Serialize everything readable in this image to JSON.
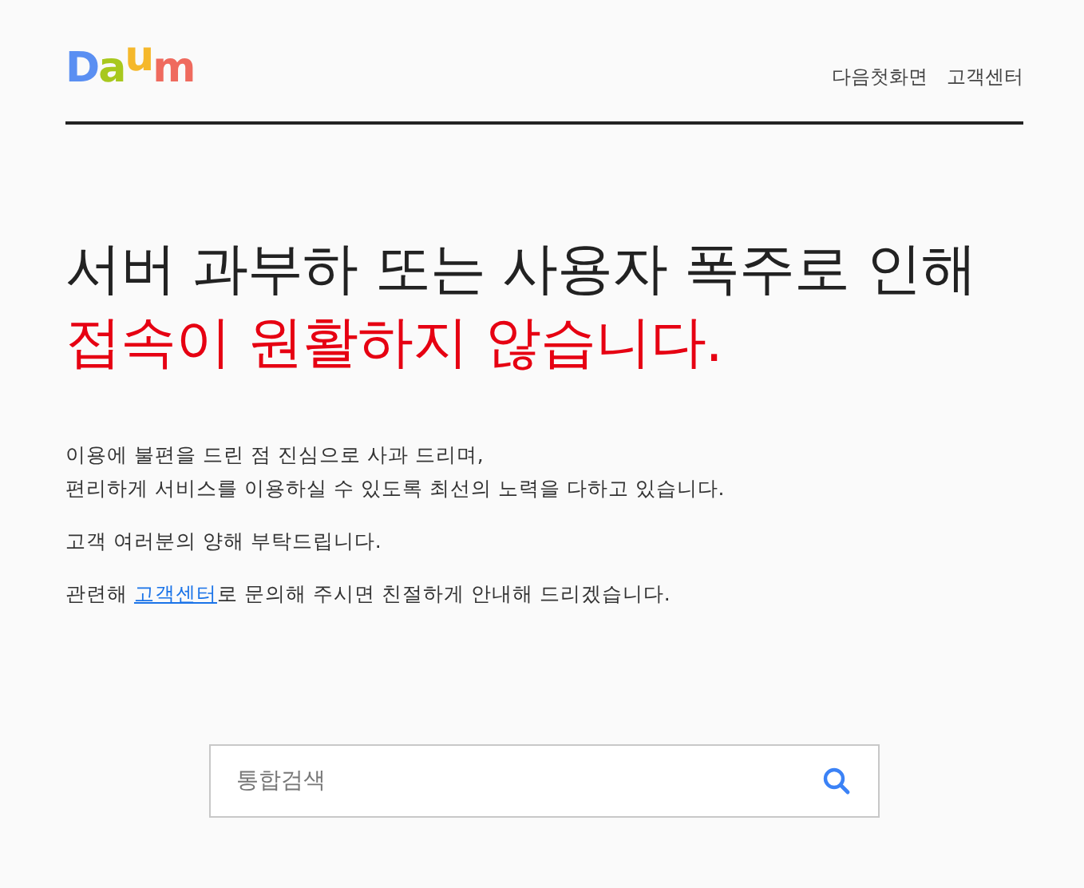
{
  "logo": {
    "letters": [
      {
        "text": "D",
        "color": "#5a8ff2"
      },
      {
        "text": "a",
        "color": "#a8c81e"
      },
      {
        "text": "u",
        "color": "#f5b82b"
      },
      {
        "text": "m",
        "color": "#ef6a5e"
      }
    ]
  },
  "nav": [
    "다음첫화면",
    "고객센터"
  ],
  "headline": {
    "line_1": "서버 과부하 또는 사용자 폭주로 인해",
    "line_2": "접속이 원활하지 않습니다."
  },
  "paragraphs": [
    {
      "lines": [
        "이용에 불편을 드린 점 진심으로 사과 드리며,",
        "편리하게 서비스를 이용하실 수 있도록 최선의 노력을 다하고 있습니다."
      ]
    },
    {
      "lines": [
        "고객 여러분의 양해 부탁드립니다."
      ]
    }
  ],
  "contact": {
    "before": "관련해 ",
    "link": "고객센터",
    "after": "로 문의해 주시면 친절하게 안내해 드리겠습니다."
  },
  "search": {
    "placeholder": "통합검색"
  }
}
